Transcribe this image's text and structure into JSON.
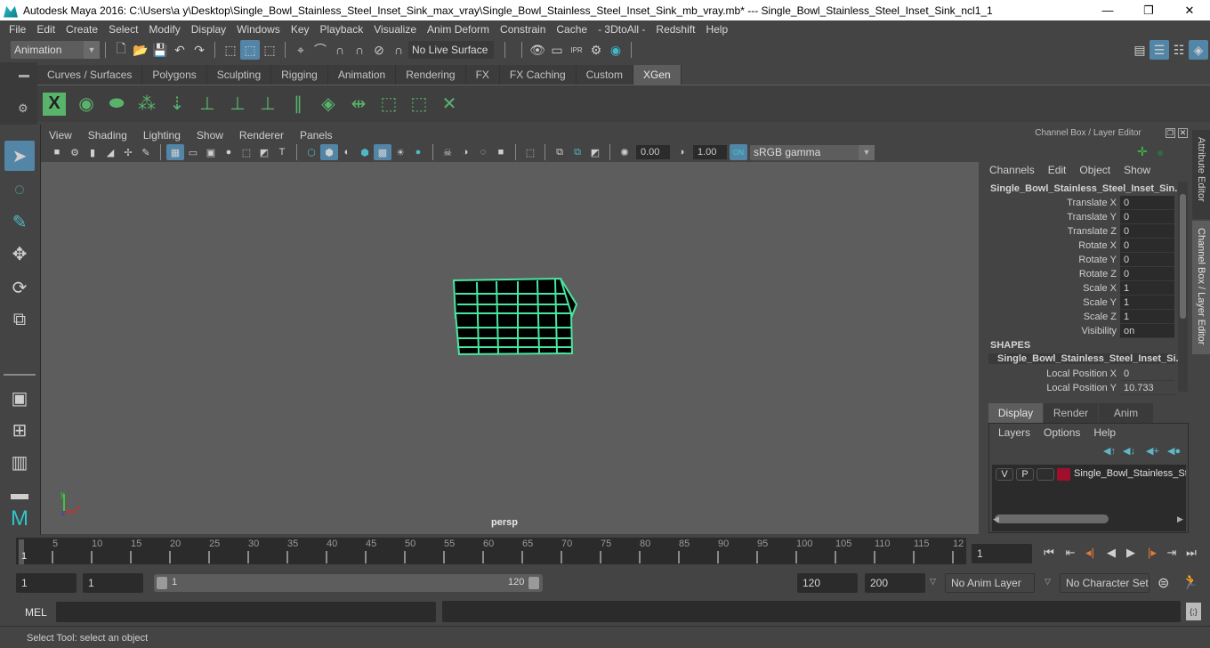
{
  "window": {
    "title": "Autodesk Maya 2016: C:\\Users\\a y\\Desktop\\Single_Bowl_Stainless_Steel_Inset_Sink_max_vray\\Single_Bowl_Stainless_Steel_Inset_Sink_mb_vray.mb*   ---   Single_Bowl_Stainless_Steel_Inset_Sink_ncl1_1",
    "minimize": "—",
    "restore": "❐",
    "close": "✕"
  },
  "menubar": [
    "File",
    "Edit",
    "Create",
    "Select",
    "Modify",
    "Display",
    "Windows",
    "Key",
    "Playback",
    "Visualize",
    "Anim Deform",
    "Constrain",
    "Cache",
    "- 3DtoAll -",
    "Redshift",
    "Help"
  ],
  "statusline": {
    "menu_set": "Animation",
    "live_surface": "No Live Surface"
  },
  "shelf": {
    "tabs": [
      "Curves / Surfaces",
      "Polygons",
      "Sculpting",
      "Rigging",
      "Animation",
      "Rendering",
      "FX",
      "FX Caching",
      "Custom",
      "XGen"
    ],
    "active_tab": "XGen"
  },
  "panel": {
    "menu": [
      "View",
      "Shading",
      "Lighting",
      "Show",
      "Renderer",
      "Panels"
    ],
    "exposure": "0.00",
    "gamma": "1.00",
    "color_mgmt_toggle": "ON",
    "color_space": "sRGB gamma",
    "camera_label": "persp",
    "axis": {
      "x": "x",
      "y": "y",
      "z": "z"
    }
  },
  "channel_box": {
    "title": "Channel Box / Layer Editor",
    "menu": [
      "Channels",
      "Edit",
      "Object",
      "Show"
    ],
    "object_name": "Single_Bowl_Stainless_Steel_Inset_Sin...",
    "attributes": [
      {
        "label": "Translate X",
        "value": "0"
      },
      {
        "label": "Translate Y",
        "value": "0"
      },
      {
        "label": "Translate Z",
        "value": "0"
      },
      {
        "label": "Rotate X",
        "value": "0"
      },
      {
        "label": "Rotate Y",
        "value": "0"
      },
      {
        "label": "Rotate Z",
        "value": "0"
      },
      {
        "label": "Scale X",
        "value": "1"
      },
      {
        "label": "Scale Y",
        "value": "1"
      },
      {
        "label": "Scale Z",
        "value": "1"
      },
      {
        "label": "Visibility",
        "value": "on"
      }
    ],
    "shapes_header": "SHAPES",
    "shape_name": "Single_Bowl_Stainless_Steel_Inset_Si...",
    "shape_attributes": [
      {
        "label": "Local Position X",
        "value": "0"
      },
      {
        "label": "Local Position Y",
        "value": "10.733"
      }
    ]
  },
  "side_tabs": {
    "attribute_editor": "Attribute Editor",
    "channel_box": "Channel Box / Layer Editor"
  },
  "layer_editor": {
    "tabs": [
      "Display",
      "Render",
      "Anim"
    ],
    "active_tab": "Display",
    "menu": [
      "Layers",
      "Options",
      "Help"
    ],
    "layers": [
      {
        "visible": "V",
        "playback": "P",
        "color": "#a0102c",
        "name": "Single_Bowl_Stainless_St"
      }
    ]
  },
  "timeline": {
    "ticks": [
      "5",
      "10",
      "15",
      "20",
      "25",
      "30",
      "35",
      "40",
      "45",
      "50",
      "55",
      "60",
      "65",
      "70",
      "75",
      "80",
      "85",
      "90",
      "95",
      "100",
      "105",
      "110",
      "115",
      "12"
    ],
    "current_frame_marker": "1",
    "current_frame": "1"
  },
  "range": {
    "start_time": "1",
    "playback_start": "1",
    "range_start": "1",
    "range_end": "120",
    "playback_end": "120",
    "end_time": "200",
    "anim_layer": "No Anim Layer",
    "character_set": "No Character Set"
  },
  "command_line": {
    "label": "MEL",
    "input": "",
    "result": ""
  },
  "help_line": "Select Tool: select an object",
  "colors": {
    "accent_blue": "#5285a6",
    "wire_green": "#48e6a0",
    "xgen_green": "#59b36a",
    "key_orange": "#e07b39"
  }
}
